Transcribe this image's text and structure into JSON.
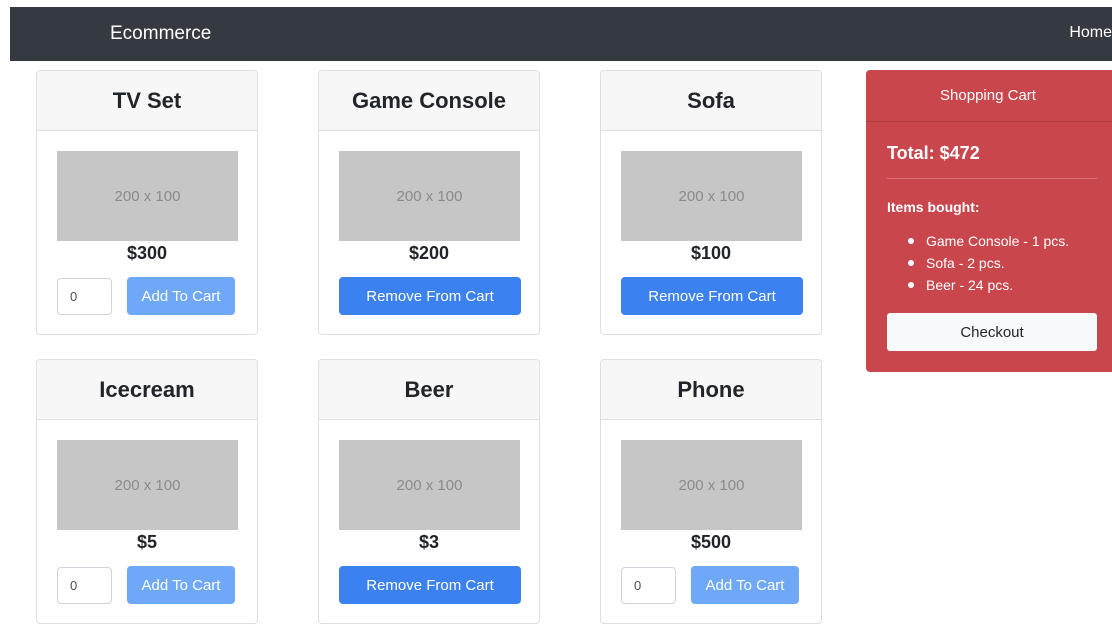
{
  "navbar": {
    "brand": "Ecommerce",
    "home": "Home"
  },
  "products": [
    {
      "name": "TV Set",
      "image_text": "200 x 100",
      "price": "$300",
      "qty": "0",
      "action": "Add To Cart"
    },
    {
      "name": "Game Console",
      "image_text": "200 x 100",
      "price": "$200",
      "action": "Remove From Cart"
    },
    {
      "name": "Sofa",
      "image_text": "200 x 100",
      "price": "$100",
      "action": "Remove From Cart"
    },
    {
      "name": "Icecream",
      "image_text": "200 x 100",
      "price": "$5",
      "qty": "0",
      "action": "Add To Cart"
    },
    {
      "name": "Beer",
      "image_text": "200 x 100",
      "price": "$3",
      "action": "Remove From Cart"
    },
    {
      "name": "Phone",
      "image_text": "200 x 100",
      "price": "$500",
      "qty": "0",
      "action": "Add To Cart"
    }
  ],
  "cart": {
    "title": "Shopping Cart",
    "total": "Total: $472",
    "items_title": "Items bought:",
    "items": [
      "Game Console - 1 pcs.",
      "Sofa - 2 pcs.",
      "Beer - 24 pcs."
    ],
    "checkout": "Checkout"
  },
  "colors": {
    "navbar": "#343a40",
    "cart": "#c9464c",
    "add_button": "#6ea8f7",
    "remove_button": "#3b82f0"
  }
}
